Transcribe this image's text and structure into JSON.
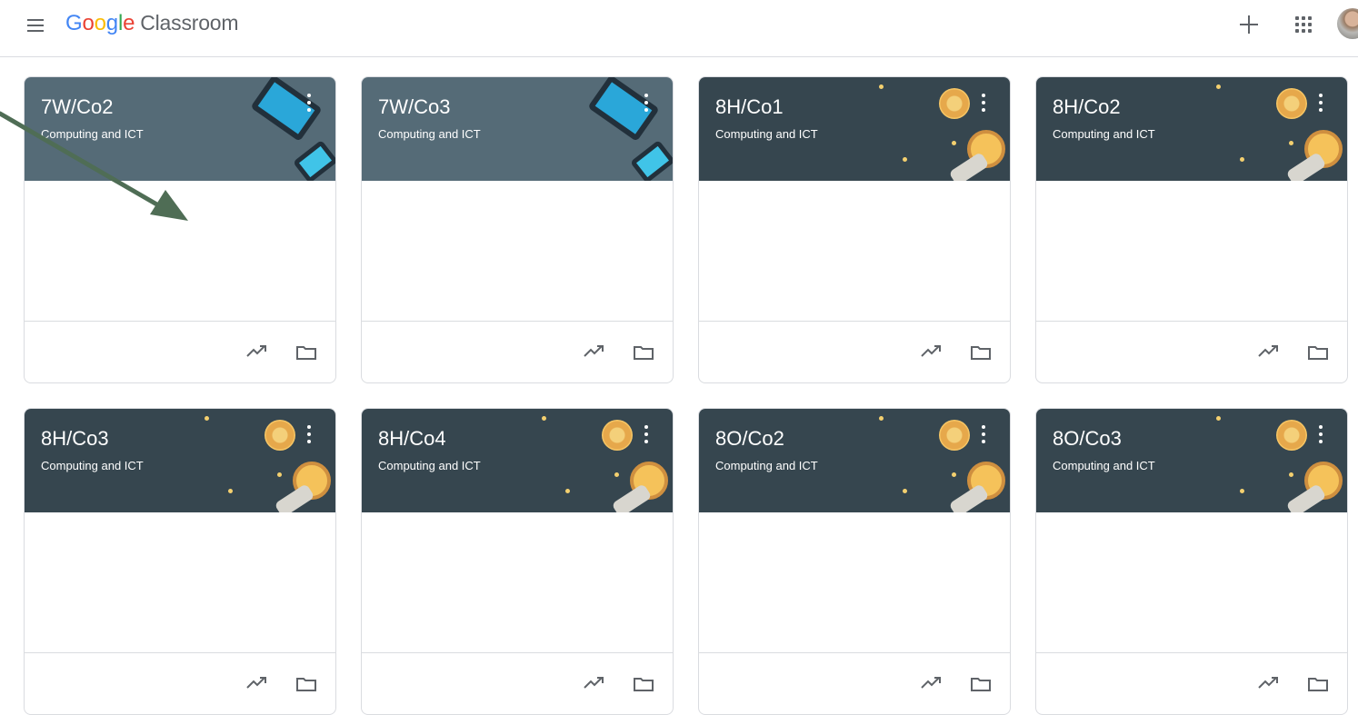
{
  "app": {
    "brand": "Google",
    "product": "Classroom"
  },
  "colors": {
    "blue": "#4285f4",
    "red": "#ea4335",
    "yellow": "#fbbc05",
    "green": "#34a853"
  },
  "icons": {
    "menu": "hamburger-icon",
    "create": "plus-icon",
    "apps": "grid-icon",
    "account": "avatar",
    "card_more": "more-vertical-icon",
    "card_progress": "trending-icon",
    "card_folder": "folder-icon"
  },
  "cards": [
    {
      "title": "7W/Co2",
      "subtitle": "Computing and ICT",
      "theme": "tech"
    },
    {
      "title": "7W/Co3",
      "subtitle": "Computing and ICT",
      "theme": "tech"
    },
    {
      "title": "8H/Co1",
      "subtitle": "Computing and ICT",
      "theme": "space"
    },
    {
      "title": "8H/Co2",
      "subtitle": "Computing and ICT",
      "theme": "space"
    },
    {
      "title": "8H/Co3",
      "subtitle": "Computing and ICT",
      "theme": "space"
    },
    {
      "title": "8H/Co4",
      "subtitle": "Computing and ICT",
      "theme": "space"
    },
    {
      "title": "8O/Co2",
      "subtitle": "Computing and ICT",
      "theme": "space"
    },
    {
      "title": "8O/Co3",
      "subtitle": "Computing and ICT",
      "theme": "space"
    }
  ]
}
